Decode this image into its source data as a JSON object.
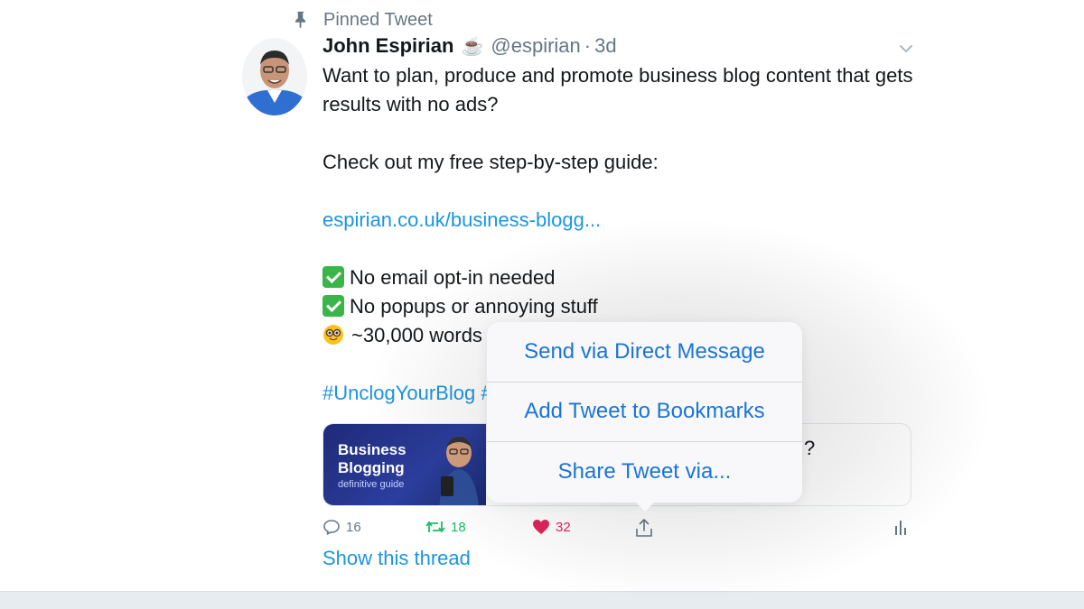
{
  "pinned": {
    "label": "Pinned Tweet",
    "icon": "pin-icon"
  },
  "tweet": {
    "author_name": "John Espirian",
    "author_emoji": "☕️",
    "handle": "@espirian",
    "separator": "·",
    "time": "3d",
    "lines": {
      "l1": "Want to plan, produce and promote business blog content that gets",
      "l2": "results with no ads?",
      "l3": "Check out my free step-by-step guide:",
      "link": "espirian.co.uk/business-blogg...",
      "b1": "No email opt-in needed",
      "b2": "No popups or annoying stuff",
      "b3": "~30,000 words",
      "hashtags": "#UnclogYourBlog #"
    }
  },
  "card": {
    "image_title_1": "Business",
    "image_title_2": "Blogging",
    "image_subtitle": "definitive guide",
    "text_fragment": "?"
  },
  "actions": {
    "reply_count": "16",
    "retweet_count": "18",
    "like_count": "32"
  },
  "show_thread": "Show this thread",
  "share_menu": {
    "items": [
      {
        "label": "Send via Direct Message"
      },
      {
        "label": "Add Tweet to Bookmarks"
      },
      {
        "label": "Share Tweet via..."
      }
    ]
  },
  "colors": {
    "link": "#1b95e0",
    "retweet": "#17bf63",
    "like": "#e0245e",
    "menu_text": "#1a74d6",
    "muted": "#657786"
  }
}
